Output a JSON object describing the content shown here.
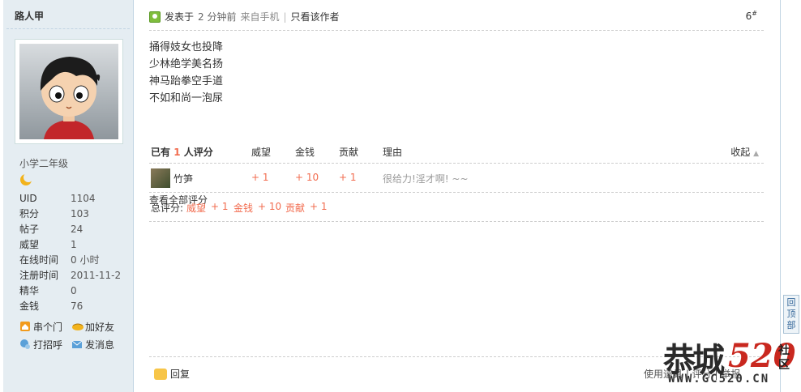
{
  "author": {
    "name": "路人甲",
    "level": "小学二年级",
    "stats": [
      {
        "label": "UID",
        "value": "1104"
      },
      {
        "label": "积分",
        "value": "103"
      },
      {
        "label": "帖子",
        "value": "24"
      },
      {
        "label": "威望",
        "value": "1"
      },
      {
        "label": "在线时间",
        "value": "0 小时"
      },
      {
        "label": "注册时间",
        "value": "2011-11-2"
      },
      {
        "label": "精华",
        "value": "0"
      },
      {
        "label": "金钱",
        "value": "76"
      }
    ],
    "actions": {
      "visit": "串个门",
      "add_friend": "加好友",
      "greet": "打招呼",
      "message": "发消息"
    }
  },
  "post": {
    "posted_label": "发表于",
    "posted_time": "2 分钟前",
    "from": "来自手机",
    "separator": "|",
    "author_only": "只看该作者",
    "floor": "6",
    "floor_mark": "#",
    "lines": [
      "捅得妓女也投降",
      "少林绝学美名扬",
      "神马跆拳空手道",
      "不如和尚一泡尿"
    ]
  },
  "rating": {
    "header": {
      "count_prefix": "已有",
      "count": "1",
      "count_suffix": "人评分",
      "col_prestige": "威望",
      "col_money": "金钱",
      "col_contrib": "贡献",
      "col_reason": "理由",
      "collapse": "收起"
    },
    "rows": [
      {
        "user": "竹笋",
        "prestige": "+ 1",
        "money": "+ 10",
        "contrib": "+ 1",
        "reason": "很给力!淫才啊! ~~"
      }
    ],
    "total": {
      "label": "总评分:",
      "prestige_label": "威望",
      "prestige": "+ 1",
      "money_label": "金钱",
      "money": "+ 10",
      "contrib_label": "贡献",
      "contrib": "+ 1",
      "view_all": "查看全部评分"
    }
  },
  "footer": {
    "reply": "回复",
    "use_hint": "使用道具 | 评分 | 举报"
  },
  "back_to_top": "回顶部",
  "watermark": {
    "brand": "恭城",
    "number": "520",
    "she": "社",
    "qu": "区",
    "url": "WWW.GC520.CN"
  },
  "colors": {
    "sidebar_bg": "#e5edf2",
    "rating_value": "#f26c4f"
  }
}
